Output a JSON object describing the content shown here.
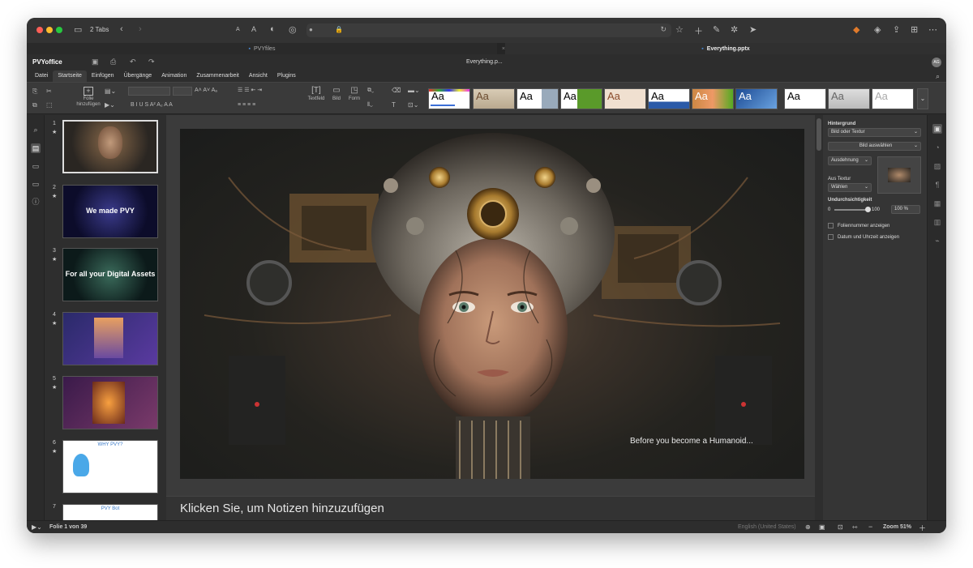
{
  "browser": {
    "tabs_label": "2 Tabs",
    "tab1": "PVYfiles",
    "tab2": "Everything.pptx"
  },
  "app": {
    "logo": "PVYoffice",
    "doc_title": "Everything.p...",
    "avatar": "AG"
  },
  "menu": {
    "items": [
      "Datei",
      "Startseite",
      "Einfügen",
      "Übergänge",
      "Animation",
      "Zusammenarbeit",
      "Ansicht",
      "Plugins"
    ]
  },
  "ribbon": {
    "add_slide": "Folie hinzufügen",
    "textbox": "Textfeld",
    "image": "Bild",
    "shape": "Form",
    "theme_label": "Aa"
  },
  "slides": [
    {
      "num": "1",
      "text": ""
    },
    {
      "num": "2",
      "text": "We made PVY"
    },
    {
      "num": "3",
      "text": "For all your Digital Assets"
    },
    {
      "num": "4",
      "text": ""
    },
    {
      "num": "5",
      "text": ""
    },
    {
      "num": "6",
      "text": "WHY PVY?"
    },
    {
      "num": "7",
      "text": "PVY Bot"
    }
  ],
  "slide": {
    "caption": "Before you become a Humanoid..."
  },
  "notes": {
    "placeholder": "Klicken Sie, um Notizen hinzuzufügen"
  },
  "props": {
    "background": "Hintergrund",
    "fill_type": "Bild oder Textur",
    "choose_image": "Bild auswählen",
    "stretch": "Ausdehnung",
    "from_texture": "Aus Textur",
    "select": "Wählen",
    "opacity": "Undurchsichtigkeit",
    "opacity_min": "0",
    "opacity_max": "100",
    "opacity_value": "100 %",
    "slide_number": "Foliennummer anzeigen",
    "date_time": "Datum und Uhrzeit anzeigen"
  },
  "status": {
    "slide_counter": "Folie 1 von 39",
    "language": "English (United States)",
    "zoom": "Zoom 51%"
  }
}
